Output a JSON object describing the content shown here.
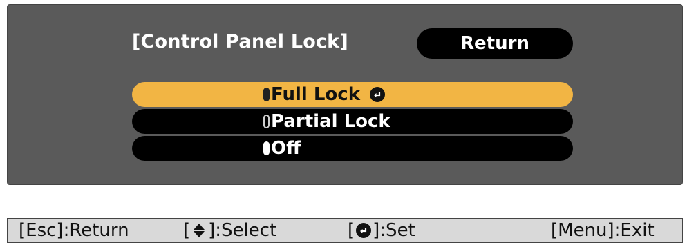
{
  "dialog": {
    "title": "[Control Panel Lock]",
    "return_label": "Return"
  },
  "options": [
    {
      "label": "Full Lock",
      "selected": true,
      "radio_filled": false
    },
    {
      "label": "Partial Lock",
      "selected": false,
      "radio_filled": false
    },
    {
      "label": "Off",
      "selected": false,
      "radio_filled": true
    }
  ],
  "statusbar": {
    "esc": {
      "prefix": "[Esc]",
      "suffix": ":Return"
    },
    "select": {
      "prefix": "[",
      "suffix": "]:Select",
      "icon": "up-down-icon"
    },
    "set": {
      "prefix": "[",
      "suffix": "]:Set",
      "icon": "enter-icon"
    },
    "menu": {
      "text": "[Menu]:Exit"
    }
  },
  "colors": {
    "panel_bg": "#5a5a5a",
    "highlight": "#f2b544",
    "bar_bg": "#d9d9d9"
  }
}
